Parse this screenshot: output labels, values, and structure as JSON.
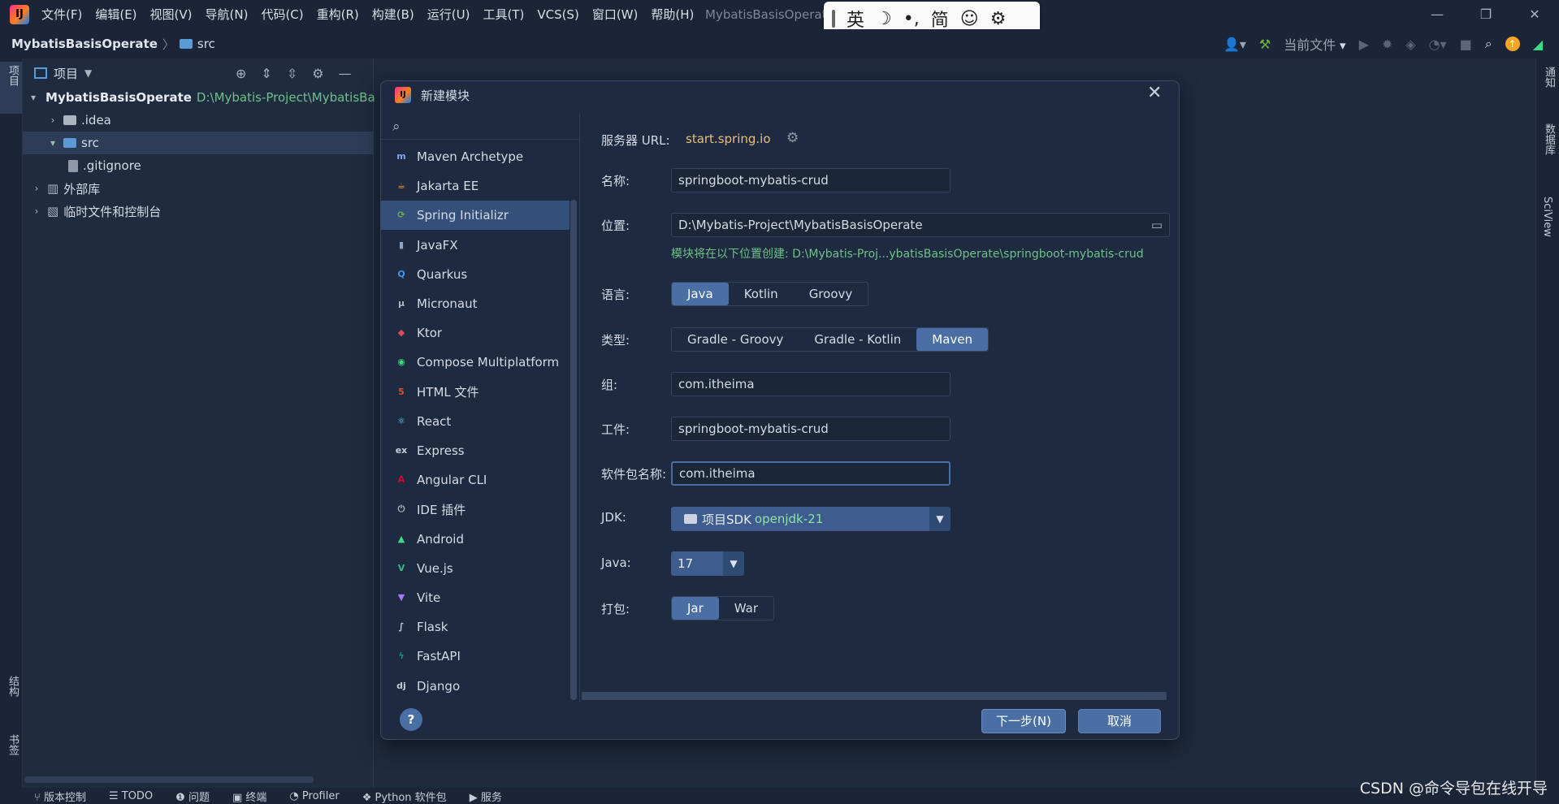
{
  "titlebar": {
    "menus": [
      "文件(F)",
      "编辑(E)",
      "视图(V)",
      "导航(N)",
      "代码(C)",
      "重构(R)",
      "构建(B)",
      "运行(U)",
      "工具(T)",
      "VCS(S)",
      "窗口(W)",
      "帮助(H)"
    ],
    "window_title": "MybatisBasisOperat",
    "ime": {
      "mode": "英",
      "moon": "☽",
      "punct": "•,",
      "simp": "简",
      "emoji": "☺",
      "gear": "⚙"
    },
    "controls": {
      "minimize": "—",
      "restore": "❐",
      "close": "✕"
    }
  },
  "navbar": {
    "project": "MybatisBasisOperate",
    "sep": "〉",
    "folder": "src",
    "run_config": "当前文件"
  },
  "left_stripe": {
    "project_tab": "项目",
    "structure_tab": "结构",
    "bookmarks_tab": "书签"
  },
  "right_stripe": {
    "notifications": "通知",
    "database": "数据库",
    "sciview": "SciView"
  },
  "project_panel": {
    "title": "项目",
    "tree": [
      {
        "name": "MybatisBasisOperate",
        "path": "D:\\Mybatis-Project\\MybatisBa"
      },
      {
        "name": ".idea"
      },
      {
        "name": "src"
      },
      {
        "name": ".gitignore"
      },
      {
        "name": "外部库"
      },
      {
        "name": "临时文件和控制台"
      }
    ]
  },
  "statusbar": {
    "items": [
      "版本控制",
      "TODO",
      "问题",
      "终端",
      "Profiler",
      "Python 软件包",
      "服务"
    ],
    "watermark": "CSDN @命令导包在线开导"
  },
  "dialog": {
    "title": "新建模块",
    "generators": [
      {
        "label": "Maven Archetype",
        "icon": "m",
        "color": "#7aa7e8"
      },
      {
        "label": "Jakarta EE",
        "icon": "☕",
        "color": "#f0a030"
      },
      {
        "label": "Spring Initializr",
        "icon": "⟳",
        "color": "#6db33f"
      },
      {
        "label": "JavaFX",
        "icon": "▮",
        "color": "#8fa4c2"
      },
      {
        "label": "Quarkus",
        "icon": "Q",
        "color": "#4695eb"
      },
      {
        "label": "Micronaut",
        "icon": "μ",
        "color": "#b0b7c3"
      },
      {
        "label": "Ktor",
        "icon": "◆",
        "color": "#e44857"
      },
      {
        "label": "Compose Multiplatform",
        "icon": "◉",
        "color": "#3ddc84"
      },
      {
        "label": "HTML 文件",
        "icon": "5",
        "color": "#e44d26"
      },
      {
        "label": "React",
        "icon": "⚛",
        "color": "#61dafb"
      },
      {
        "label": "Express",
        "icon": "ex",
        "color": "#c6cdd8"
      },
      {
        "label": "Angular CLI",
        "icon": "A",
        "color": "#dd0031"
      },
      {
        "label": "IDE 插件",
        "icon": "⏻",
        "color": "#b0b7c3"
      },
      {
        "label": "Android",
        "icon": "▲",
        "color": "#3ddc84"
      },
      {
        "label": "Vue.js",
        "icon": "V",
        "color": "#42b883"
      },
      {
        "label": "Vite",
        "icon": "▼",
        "color": "#a978ff"
      },
      {
        "label": "Flask",
        "icon": "∫",
        "color": "#c6cdd8"
      },
      {
        "label": "FastAPI",
        "icon": "ϟ",
        "color": "#059487"
      },
      {
        "label": "Django",
        "icon": "dj",
        "color": "#c6cdd8"
      }
    ],
    "selected_generator": "Spring Initializr",
    "server_url_label": "服务器 URL:",
    "server_url": "start.spring.io",
    "name_label": "名称:",
    "name": "springboot-mybatis-crud",
    "location_label": "位置:",
    "location": "D:\\Mybatis-Project\\MybatisBasisOperate",
    "location_hint": "模块将在以下位置创建: D:\\Mybatis-Proj...ybatisBasisOperate\\springboot-mybatis-crud",
    "language_label": "语言:",
    "languages": [
      "Java",
      "Kotlin",
      "Groovy"
    ],
    "language_selected": "Java",
    "type_label": "类型:",
    "types": [
      "Gradle - Groovy",
      "Gradle - Kotlin",
      "Maven"
    ],
    "type_selected": "Maven",
    "group_label": "组:",
    "group": "com.itheima",
    "artifact_label": "工件:",
    "artifact": "springboot-mybatis-crud",
    "package_label": "软件包名称:",
    "package": "com.itheima",
    "jdk_label": "JDK:",
    "jdk_prefix": "项目SDK",
    "jdk_value": "openjdk-21",
    "java_label": "Java:",
    "java_version": "17",
    "packaging_label": "打包:",
    "packaging": [
      "Jar",
      "War"
    ],
    "packaging_selected": "Jar",
    "help": "?",
    "next_button": "下一步(N)",
    "cancel_button": "取消"
  }
}
